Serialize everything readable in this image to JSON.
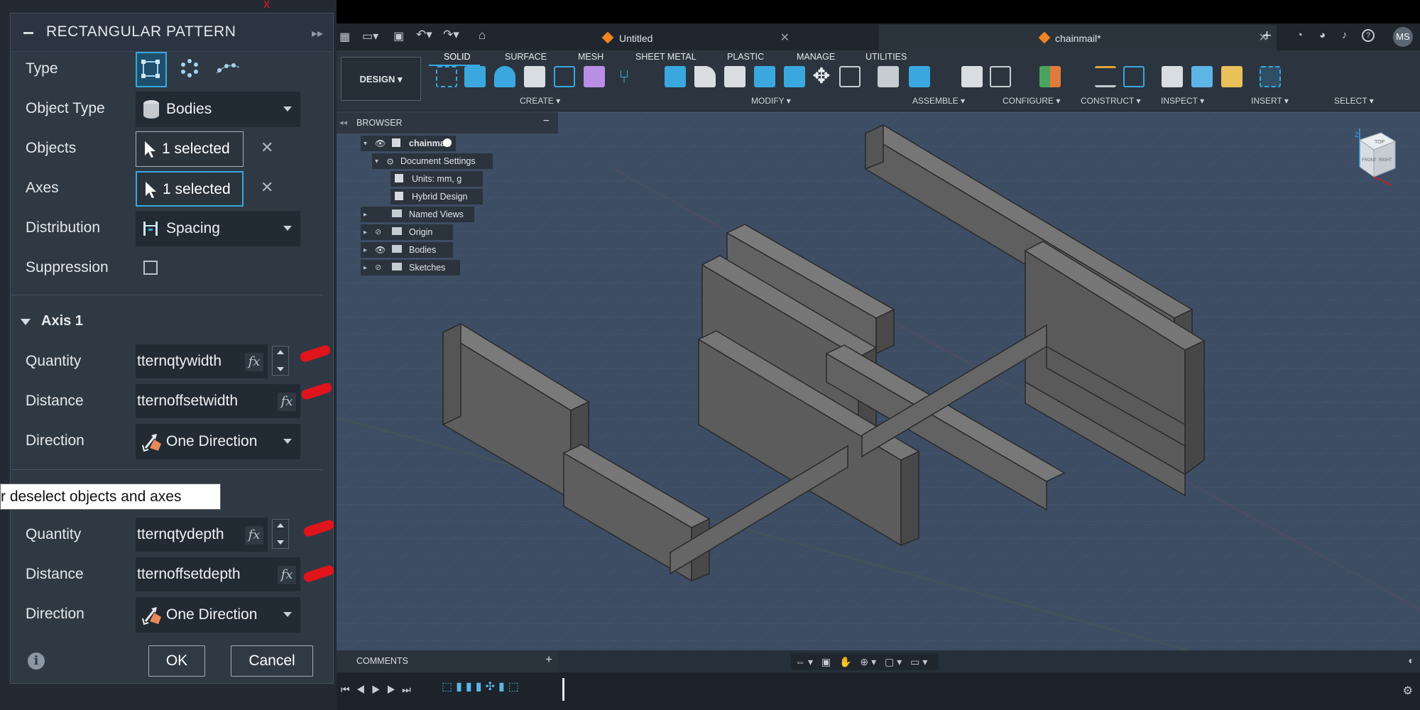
{
  "dialog": {
    "title": "RECTANGULAR PATTERN",
    "type_label": "Type",
    "object_type": {
      "label": "Object Type",
      "value": "Bodies"
    },
    "objects": {
      "label": "Objects",
      "value": "1 selected"
    },
    "axes": {
      "label": "Axes",
      "value": "1 selected"
    },
    "distribution": {
      "label": "Distribution",
      "value": "Spacing"
    },
    "suppression": {
      "label": "Suppression"
    },
    "axis1": {
      "title": "Axis 1",
      "quantity": {
        "label": "Quantity",
        "value": "tternqtywidth"
      },
      "distance": {
        "label": "Distance",
        "value": "tternoffsetwidth"
      },
      "direction": {
        "label": "Direction",
        "value": "One Direction"
      }
    },
    "axis2": {
      "quantity": {
        "label": "Quantity",
        "value": "tternqtydepth"
      },
      "distance": {
        "label": "Distance",
        "value": "tternoffsetdepth"
      },
      "direction": {
        "label": "Direction",
        "value": "One Direction"
      }
    },
    "tooltip": "r deselect objects and axes",
    "ok": "OK",
    "cancel": "Cancel",
    "fx": "fx"
  },
  "app": {
    "tabs": [
      {
        "label": "Untitled"
      },
      {
        "label": "chainmail*"
      }
    ],
    "user_initials": "MS",
    "workspace": "DESIGN",
    "ribbon_tabs": [
      "SOLID",
      "SURFACE",
      "MESH",
      "SHEET METAL",
      "PLASTIC",
      "MANAGE",
      "UTILITIES"
    ],
    "ribbon_groups": [
      "CREATE",
      "MODIFY",
      "ASSEMBLE",
      "CONFIGURE",
      "CONSTRUCT",
      "INSPECT",
      "INSERT",
      "SELECT"
    ],
    "browser": {
      "title": "BROWSER",
      "root": "chainmail",
      "items": [
        "Document Settings",
        "Units: mm, g",
        "Hybrid Design",
        "Named Views",
        "Origin",
        "Bodies",
        "Sketches"
      ]
    },
    "comments": "COMMENTS",
    "viewcube": {
      "top": "TOP",
      "front": "FRONT",
      "right": "RIGHT"
    }
  }
}
